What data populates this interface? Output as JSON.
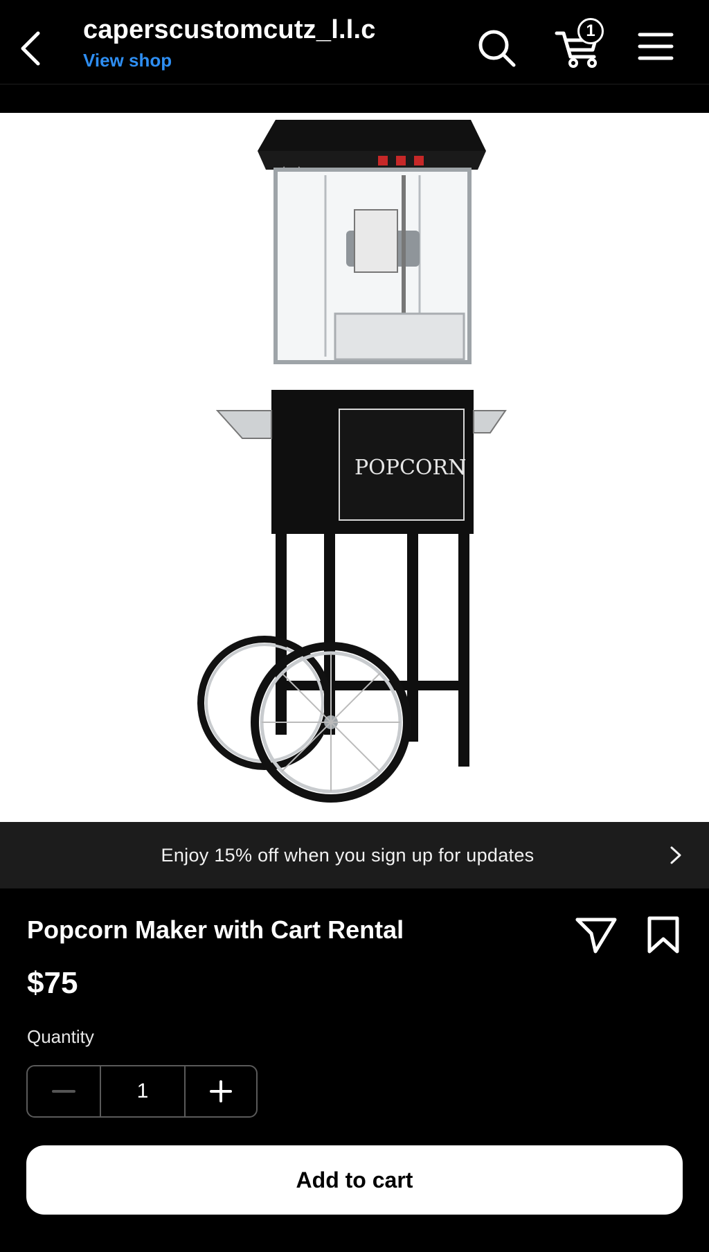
{
  "header": {
    "shop_name": "caperscustomcutz_l.l.c",
    "view_shop": "View shop",
    "cart_count": "1",
    "icons": [
      "back-chevron-icon",
      "search-icon",
      "cart-icon",
      "menu-icon"
    ]
  },
  "promo": {
    "text": "Enjoy 15% off when you sign up for updates"
  },
  "product": {
    "title": "Popcorn Maker with Cart Rental",
    "price": "$75",
    "quantity_label": "Quantity",
    "quantity_value": "1",
    "add_to_cart": "Add to cart",
    "image_label": "POPCORN"
  },
  "colors": {
    "background": "#000000",
    "link": "#2e8ef2",
    "banner": "#1c1c1c",
    "button": "#ffffff"
  }
}
